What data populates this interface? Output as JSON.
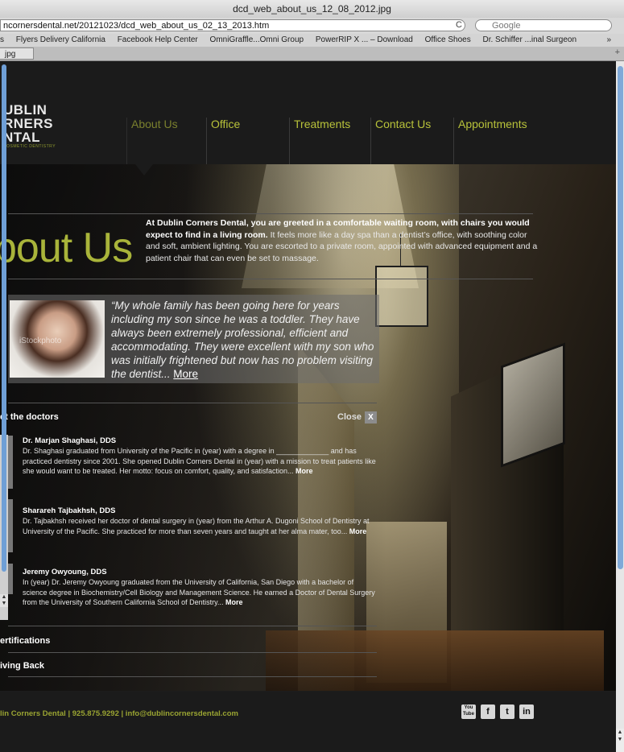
{
  "browser": {
    "window_title": "dcd_web_about_us_12_08_2012.jpg",
    "url": "ncornersdental.net/20121023/dcd_web_about_us_02_13_2013.htm",
    "search_placeholder": "Google",
    "bookmarks": [
      "s",
      "Flyers Delivery California",
      "Facebook Help Center",
      "OmniGraffle...Omni Group",
      "PowerRIP X ... – Download",
      "Office Shoes",
      "Dr. Schiffer ...inal Surgeon"
    ],
    "bookmarks_more": "»",
    "tab_label": "jpg",
    "tab_plus": "+",
    "reload_icon": "C",
    "search_icon": "Q▾"
  },
  "logo": {
    "line1": "UBLIN",
    "line2": "RNERS",
    "line3": "NTAL",
    "tagline": "COSMETIC DENTISTRY"
  },
  "nav": {
    "items": [
      "About Us",
      "Office",
      "Treatments",
      "Contact Us",
      "Appointments"
    ],
    "active": "About Us"
  },
  "about": {
    "title": "bout Us",
    "intro_bold": "At Dublin Corners Dental, you are greeted in a comfortable waiting room, with chairs you would expect to find in a living room.",
    "intro_rest": " It feels more like a day spa than a dentist’s office, with soothing color and soft, ambient lighting. You are escorted to a private room, appointed with advanced equipment and a patient chair that can even be set to massage."
  },
  "testimonial": {
    "photo_watermark": "iStockphoto",
    "quote": "“My whole family has been going here for years including my son since he was a toddler. They have always been extremely professional, efficient and accommodating. They were excellent with my son who was initially frightened but now has no problem visiting the dentist... ",
    "more": "More"
  },
  "doctors": {
    "heading": "et the doctors",
    "close_label": "Close",
    "close_x": "X",
    "list": [
      {
        "name": "Dr. Marjan Shaghasi, DDS",
        "bio": "Dr. Shaghasi graduated from University of the Pacific in (year) with a degree in _____________ and has practiced dentistry since 2001. She opened Dublin Corners Dental in (year) with a mission to treat patients like she would want to be treated. Her motto: focus on comfort, quality, and satisfaction... ",
        "more": "More"
      },
      {
        "name": "Sharareh Tajbakhsh, DDS",
        "bio": "Dr. Tajbakhsh received her doctor of dental surgery in (year) from the Arthur A. Dugoni School of Dentistry at University of the Pacific. She practiced for more than seven years and taught at her alma mater, too... ",
        "more": "More"
      },
      {
        "name": "Jeremy Owyoung, DDS",
        "bio": "In (year) Dr. Jeremy Owyoung graduated from the University of California, San Diego with a bachelor of science degree in Biochemistry/Cell Biology and Management Science. He earned a Doctor of Dental Surgery from the University of Southern California School of Dentistry... ",
        "more": "More"
      }
    ]
  },
  "sections": {
    "certifications": "ertifications",
    "giving_back": "iving Back"
  },
  "footer": {
    "text": "lin Corners Dental  |  925.875.9292  |  info@dublincornersdental.com",
    "social": [
      "You Tube",
      "f",
      "t",
      "in"
    ]
  },
  "colors": {
    "accent": "#a9b43a",
    "background": "#1b1b1b"
  }
}
